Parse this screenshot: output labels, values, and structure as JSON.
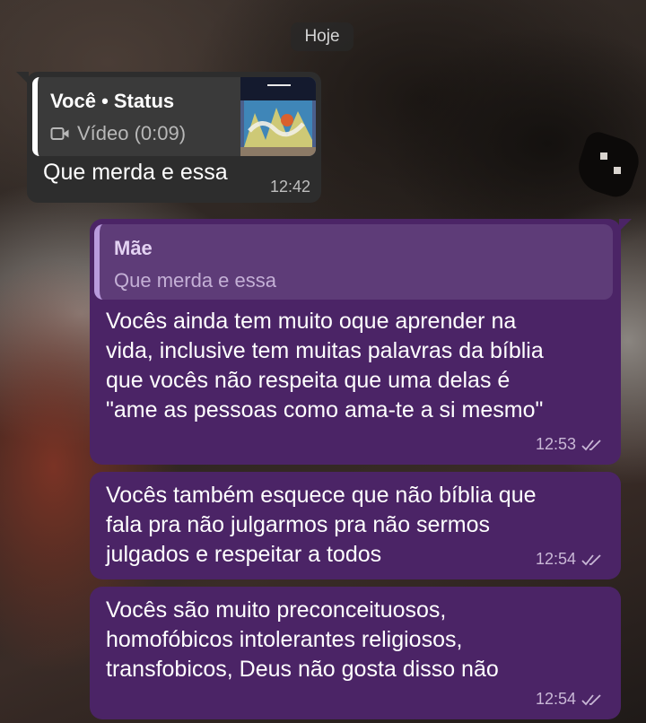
{
  "date_separator": "Hoje",
  "incoming": {
    "quote": {
      "author": "Você • Status",
      "media_label": "Vídeo (0:09)",
      "icon": "video-camera-icon"
    },
    "text": "Que merda e essa",
    "time": "12:42"
  },
  "outgoing": [
    {
      "reply_to": {
        "author": "Mãe",
        "text": "Que merda e essa"
      },
      "lines": [
        "Vocês ainda tem muito oque aprender na",
        "vida, inclusive tem muitas palavras da bíblia",
        "que vocês não respeita que uma delas é",
        "\"ame as pessoas como ama-te a si mesmo\""
      ],
      "time": "12:53",
      "status_icon": "double-check-icon"
    },
    {
      "lines": [
        "Vocês também esquece que não bíblia que",
        "fala pra não julgarmos pra não sermos",
        "julgados e respeitar a todos"
      ],
      "time": "12:54",
      "status_icon": "double-check-icon"
    },
    {
      "lines": [
        "Vocês são muito preconceituosos,",
        "homofóbicos intolerantes religiosos,",
        "transfobicos, Deus não gosta disso não"
      ],
      "time": "12:54",
      "status_icon": "double-check-icon"
    }
  ],
  "colors": {
    "incoming_bubble": "#2d2d2d",
    "outgoing_bubble": "#4b2466",
    "reply_quote_bar": "#b99bdd"
  }
}
